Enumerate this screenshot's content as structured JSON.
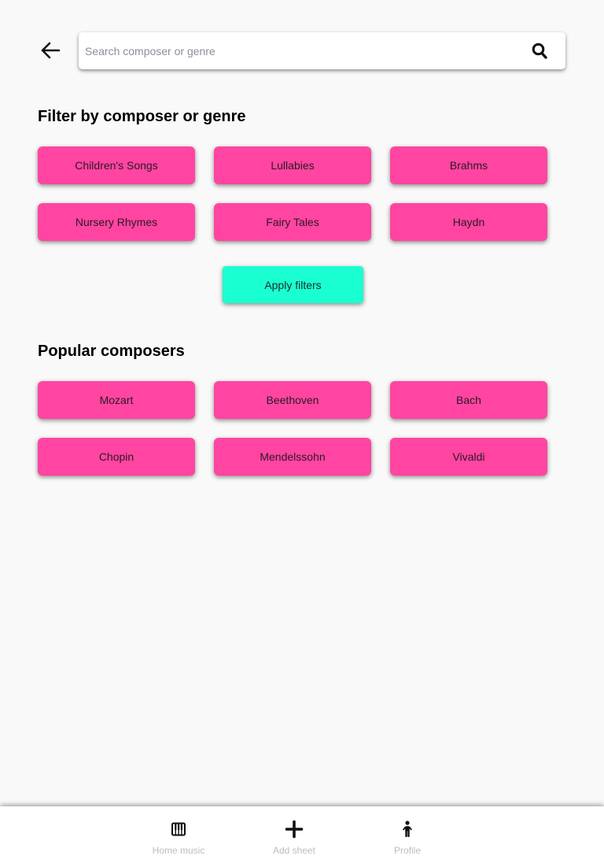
{
  "search": {
    "placeholder": "Search composer or genre"
  },
  "filter_section": {
    "title": "Filter by composer or genre",
    "chips": [
      "Children's Songs",
      "Lullabies",
      "Brahms",
      "Nursery Rhymes",
      "Fairy Tales",
      "Haydn"
    ],
    "apply_label": "Apply filters"
  },
  "popular_section": {
    "title": "Popular composers",
    "chips": [
      "Mozart",
      "Beethoven",
      "Bach",
      "Chopin",
      "Mendelssohn",
      "Vivaldi"
    ]
  },
  "bottom_nav": {
    "items": [
      {
        "label": "Home music",
        "icon": "piano-icon"
      },
      {
        "label": "Add sheet",
        "icon": "plus-icon"
      },
      {
        "label": "Profile",
        "icon": "child-icon"
      }
    ]
  },
  "colors": {
    "chip": "#ff45a1",
    "apply_button": "#1affd1",
    "background": "#f9f9f9",
    "nav_label": "#bdbdbd"
  }
}
